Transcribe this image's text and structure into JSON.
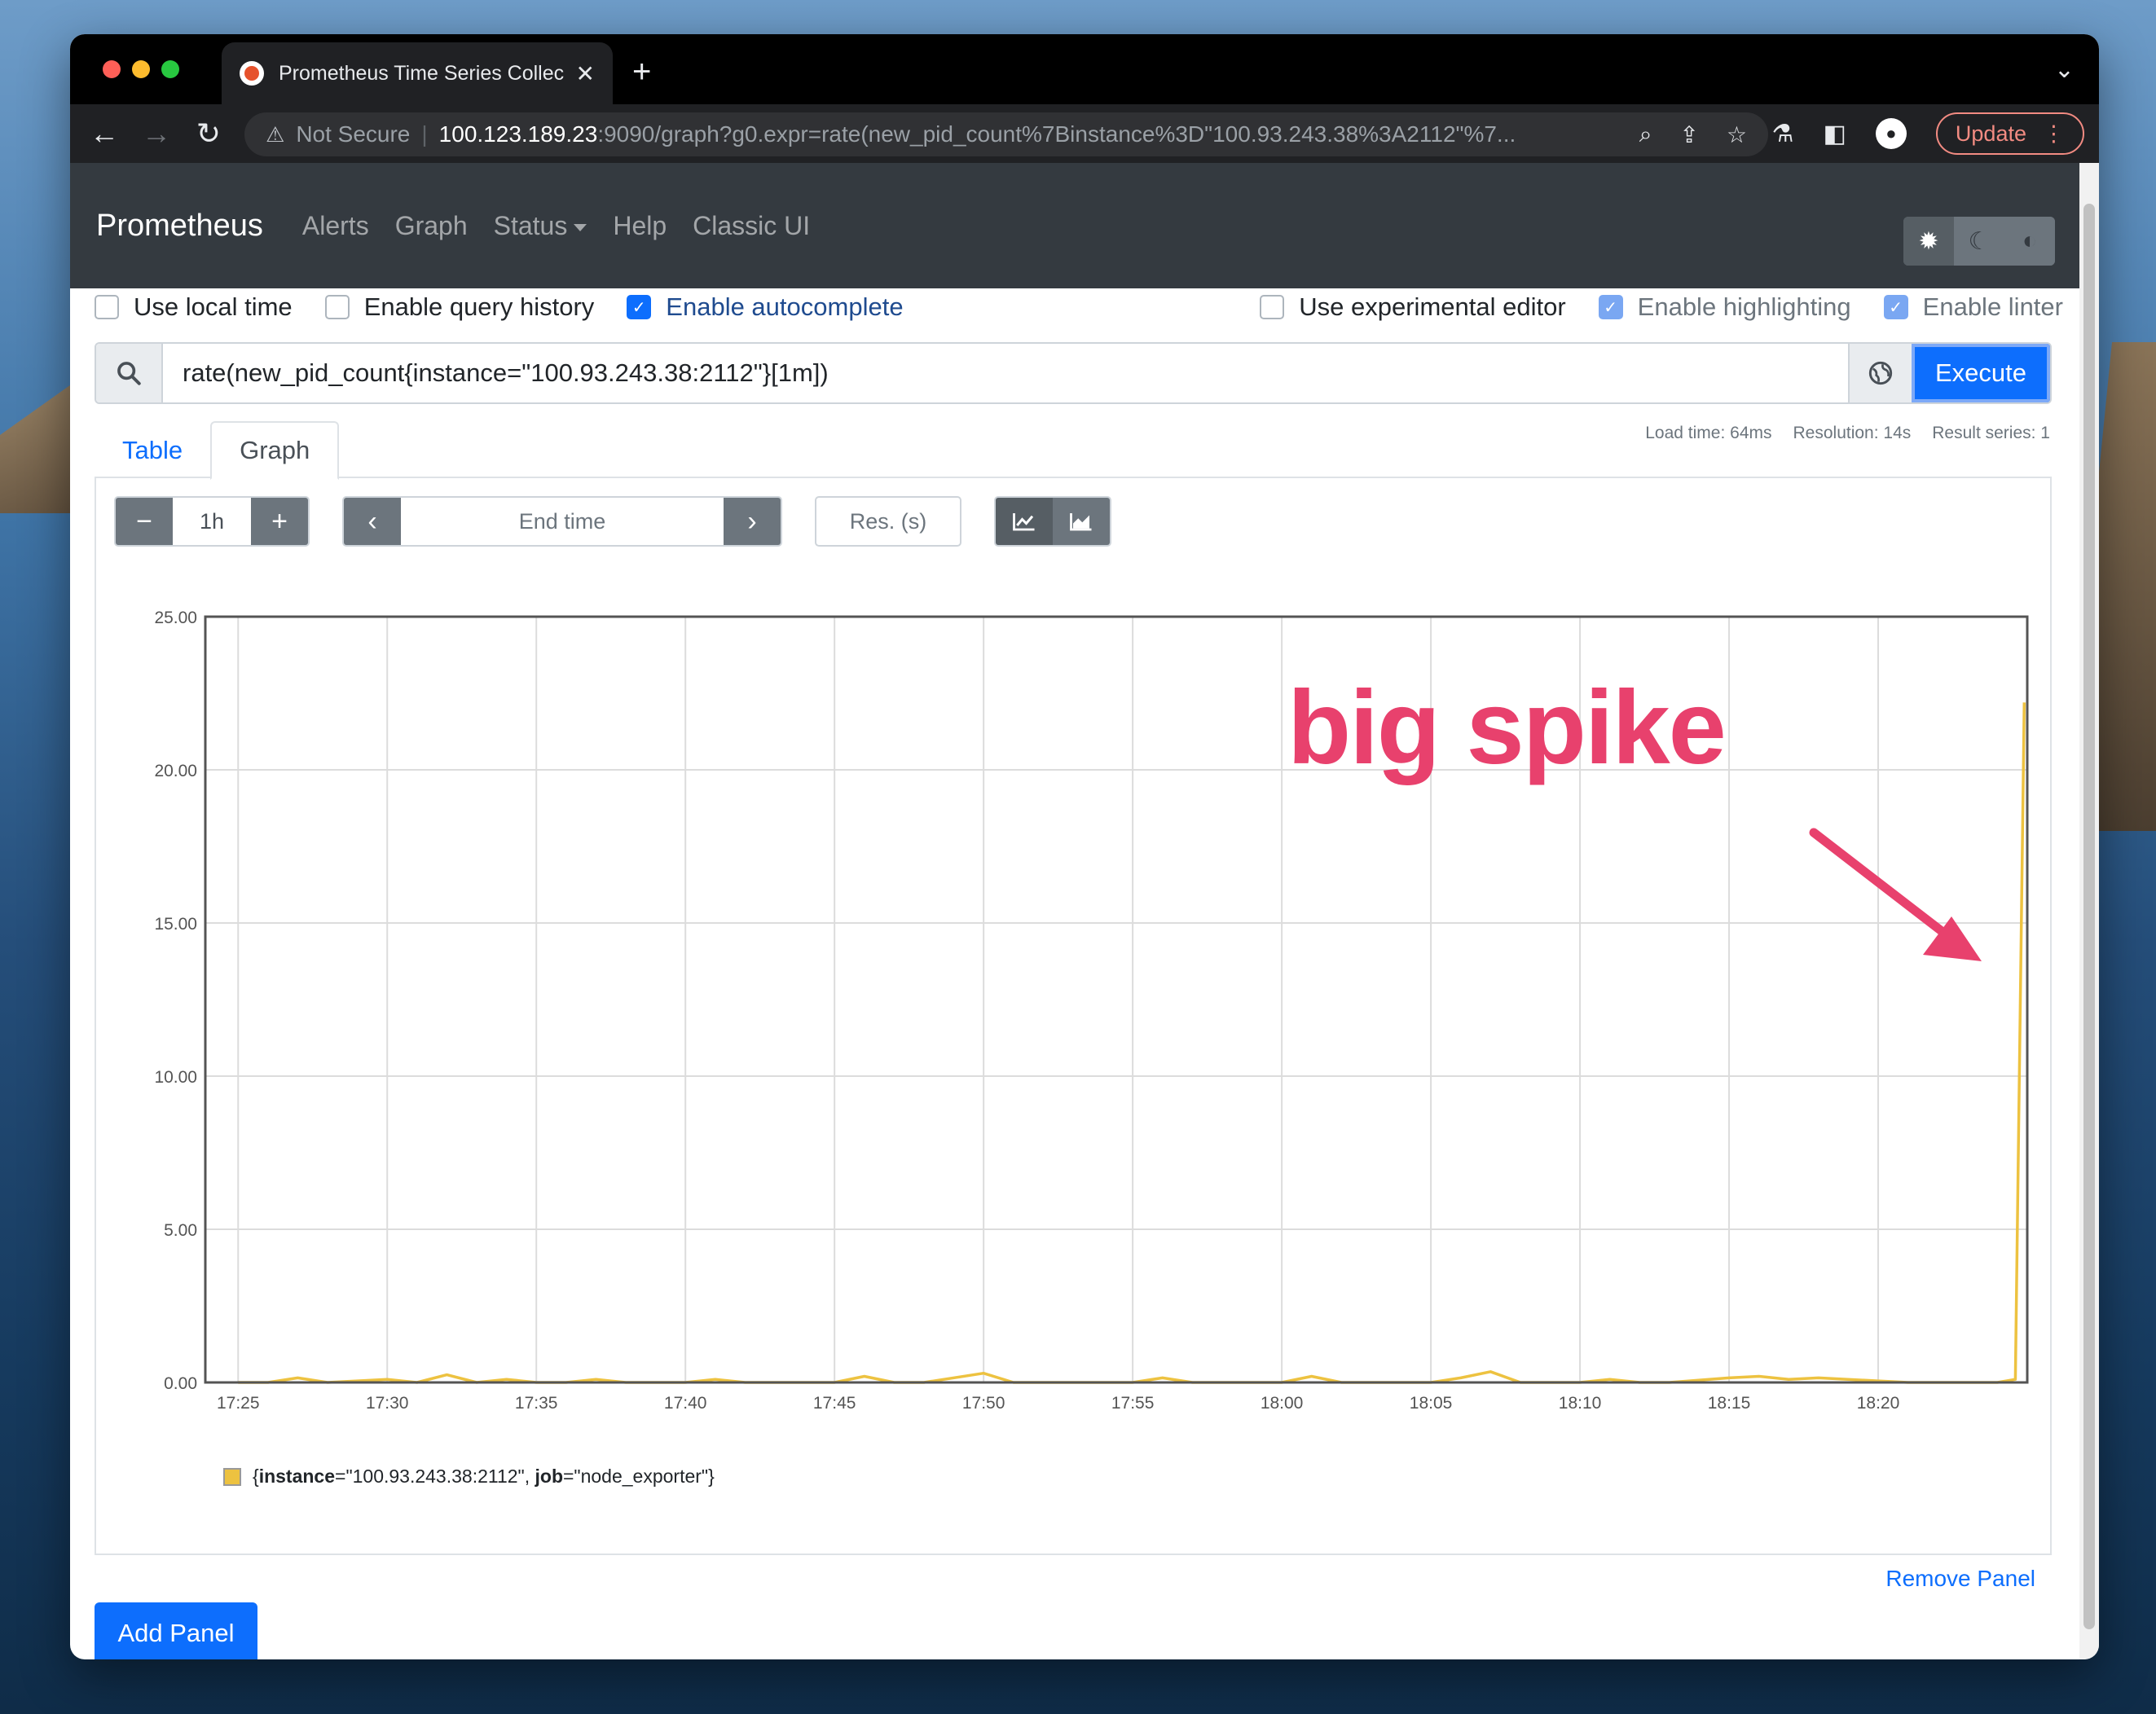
{
  "browser": {
    "tab_title": "Prometheus Time Series Collec",
    "not_secure": "Not Secure",
    "url_host": "100.123.189.23",
    "url_path": ":9090/graph?g0.expr=rate(new_pid_count%7Binstance%3D\"100.93.243.38%3A2112\"%7...",
    "update_label": "Update"
  },
  "nav": {
    "brand": "Prometheus",
    "links": [
      "Alerts",
      "Graph",
      "Status",
      "Help",
      "Classic UI"
    ]
  },
  "options": {
    "use_local_time": "Use local time",
    "enable_query_history": "Enable query history",
    "enable_autocomplete": "Enable autocomplete",
    "use_experimental_editor": "Use experimental editor",
    "enable_highlighting": "Enable highlighting",
    "enable_linter": "Enable linter"
  },
  "query": {
    "expression": "rate(new_pid_count{instance=\"100.93.243.38:2112\"}[1m])",
    "execute_label": "Execute"
  },
  "stats": {
    "load_time": "Load time: 64ms",
    "resolution": "Resolution: 14s",
    "result_series": "Result series: 1"
  },
  "tabs": [
    "Table",
    "Graph"
  ],
  "controls": {
    "range": "1h",
    "end_time_placeholder": "End time",
    "res_placeholder": "Res. (s)"
  },
  "legend": {
    "k1": "instance",
    "v1": "=\"100.93.243.38:2112\", ",
    "k2": "job",
    "v2": "=\"node_exporter\"}",
    "open": "{"
  },
  "annotation": "big spike",
  "footer": {
    "remove_panel": "Remove Panel",
    "add_panel": "Add Panel"
  },
  "colors": {
    "series": "#edc240",
    "annotation": "#e8416d",
    "primary": "#0d6efd"
  },
  "chart_data": {
    "type": "line",
    "title": "",
    "xlabel": "",
    "ylabel": "",
    "ylim": [
      0,
      25
    ],
    "yticks": [
      "0.00",
      "5.00",
      "10.00",
      "15.00",
      "20.00",
      "25.00"
    ],
    "xticks": [
      "17:25",
      "17:30",
      "17:35",
      "17:40",
      "17:45",
      "17:50",
      "17:55",
      "18:00",
      "18:05",
      "18:10",
      "18:15",
      "18:20"
    ],
    "grid": true,
    "series": [
      {
        "name": "{instance=\"100.93.243.38:2112\", job=\"node_exporter\"}",
        "x_minutes": [
          0,
          1,
          2,
          3,
          5,
          6,
          7,
          8,
          9,
          10,
          11,
          12,
          13,
          15,
          16,
          17,
          18,
          20,
          21,
          22,
          23,
          25,
          26,
          27,
          28,
          30,
          31,
          32,
          33,
          35,
          36,
          37,
          38,
          40,
          41,
          42,
          43,
          45,
          46,
          47,
          48,
          50,
          51,
          52,
          53,
          55,
          56,
          57,
          58,
          59,
          59.6,
          59.9
        ],
        "values": [
          0,
          0,
          0.15,
          0,
          0.1,
          0,
          0.25,
          0,
          0.1,
          0,
          0,
          0.1,
          0,
          0,
          0.1,
          0,
          0,
          0,
          0.2,
          0,
          0,
          0.3,
          0,
          0,
          0,
          0,
          0.15,
          0,
          0,
          0,
          0.2,
          0,
          0,
          0,
          0.15,
          0.35,
          0,
          0,
          0.1,
          0,
          0,
          0.15,
          0.2,
          0.1,
          0.15,
          0.05,
          0,
          0,
          0,
          0,
          0.1,
          22.2
        ]
      }
    ]
  }
}
